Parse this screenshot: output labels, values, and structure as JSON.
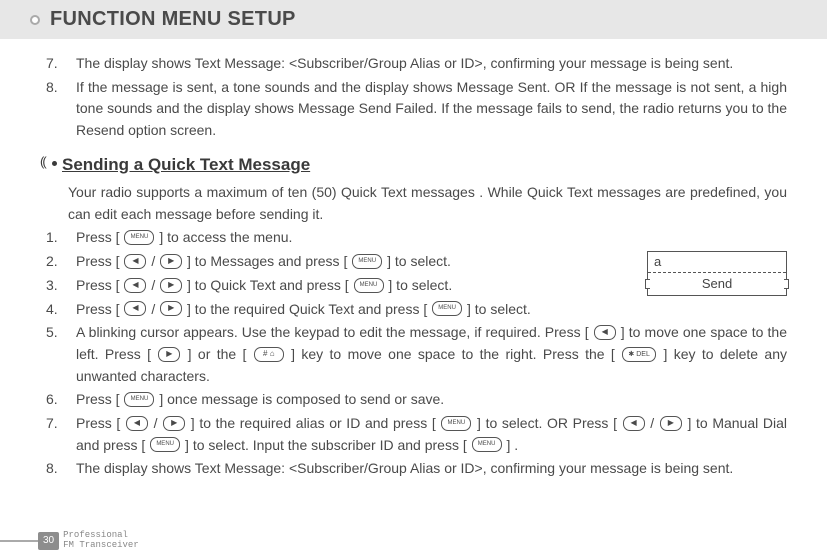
{
  "title": "FUNCTION MENU SETUP",
  "top_steps": [
    {
      "n": "7.",
      "text": "The display shows Text Message: <Subscriber/Group Alias or ID>, confirming your message is being sent."
    },
    {
      "n": "8.",
      "text": "If the message is sent, a tone sounds and the display shows Message Sent. OR If the message is not sent, a high tone sounds and the display shows Message Send Failed. If the message fails to send, the radio returns you to the Resend option screen."
    }
  ],
  "section": {
    "heading": "Sending a Quick Text Message",
    "intro": "Your radio supports a maximum of ten (50) Quick Text messages . While Quick Text messages are predefined, you can edit each message before sending it."
  },
  "keys": {
    "menu": "MENU",
    "left": "◀",
    "right": "▶",
    "del": "✱  DEL",
    "hash": "#  ⌂"
  },
  "callout": {
    "label": "a",
    "value": "Send"
  },
  "steps": {
    "s1a": "Press [ ",
    "s1b": " ] to access the menu.",
    "s2a": "Press [ ",
    "s2b": " / ",
    "s2c": " ] to Messages and press [ ",
    "s2d": " ] to select.",
    "s3a": "Press [ ",
    "s3b": " / ",
    "s3c": " ] to Quick Text and press [ ",
    "s3d": " ] to select.",
    "s4a": "Press [ ",
    "s4b": " / ",
    "s4c": " ] to the required Quick Text and press [ ",
    "s4d": " ] to select.",
    "s5a": "A blinking cursor appears. Use the keypad to edit the message, if required. Press [ ",
    "s5b": " ] to move one space to the left. Press [ ",
    "s5c": " ] or the [ ",
    "s5d": " ] key to move one space to the right. Press  the [ ",
    "s5e": " ]  key  to  delete  any  unwanted characters.",
    "s6a": "Press [ ",
    "s6b": " ] once message is composed to send or save.",
    "s7a": "Press [ ",
    "s7b": " / ",
    "s7c": " ] to the required alias or ID and press [ ",
    "s7d": " ] to select. OR Press [ ",
    "s7e": " / ",
    "s7f": " ] to Manual Dial and press [ ",
    "s7g": " ] to select. Input the subscriber ID and press [ ",
    "s7h": " ] .",
    "s8": "The display shows Text Message: <Subscriber/Group Alias or ID>, confirming your message is being sent."
  },
  "step_nums": {
    "n1": "1.",
    "n2": "2.",
    "n3": "3.",
    "n4": "4.",
    "n5": "5.",
    "n6": "6.",
    "n7": "7.",
    "n8": "8."
  },
  "footer": {
    "page": "30",
    "line1": "Professional",
    "line2": "FM Transceiver"
  }
}
